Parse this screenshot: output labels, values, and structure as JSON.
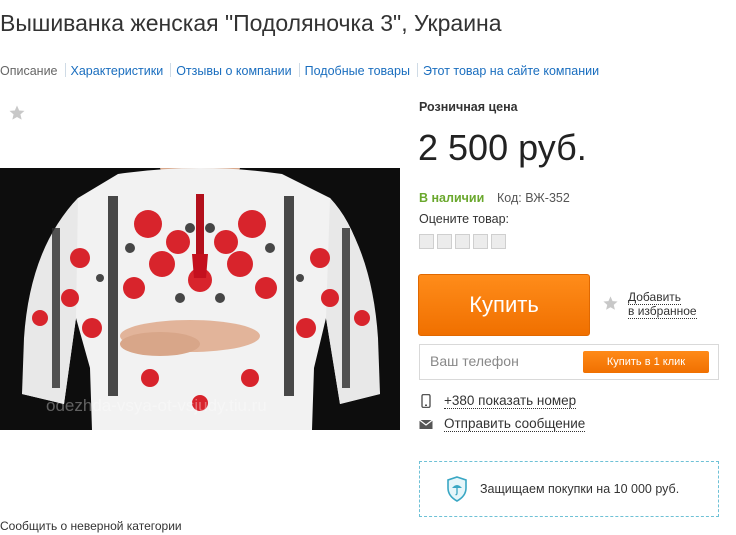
{
  "product": {
    "title": "Вышиванка женская \"Подоляночка 3\", Украина",
    "watermark": "odezhda-vsya-ot-vsjudy.tiu.ru"
  },
  "tabs": [
    {
      "label": "Описание"
    },
    {
      "label": "Характеристики"
    },
    {
      "label": "Отзывы о компании"
    },
    {
      "label": "Подобные товары"
    },
    {
      "label": "Этот товар на сайте компании"
    }
  ],
  "pricing": {
    "label": "Розничная цена",
    "price": "2 500 руб.",
    "stock": "В наличии",
    "code": "Код: ВЖ-352"
  },
  "rating": {
    "label": "Оцените товар:",
    "count": 5
  },
  "actions": {
    "buy_label": "Купить",
    "favorite_line1": "Добавить",
    "favorite_line2": "в избранное",
    "phone_placeholder": "Ваш телефон",
    "oneclick_label": "Купить в 1 клик",
    "show_number": "+380 показать номер",
    "send_message": "Отправить сообщение"
  },
  "protection": {
    "text": "Защищаем покупки на 10 000 руб."
  },
  "footer": {
    "report": "Сообщить о неверной категории"
  },
  "colors": {
    "accent_orange": "#f58220",
    "link_blue": "#1a6ebf",
    "in_stock_green": "#6aa82d",
    "protect_border": "#6ec1d6"
  }
}
